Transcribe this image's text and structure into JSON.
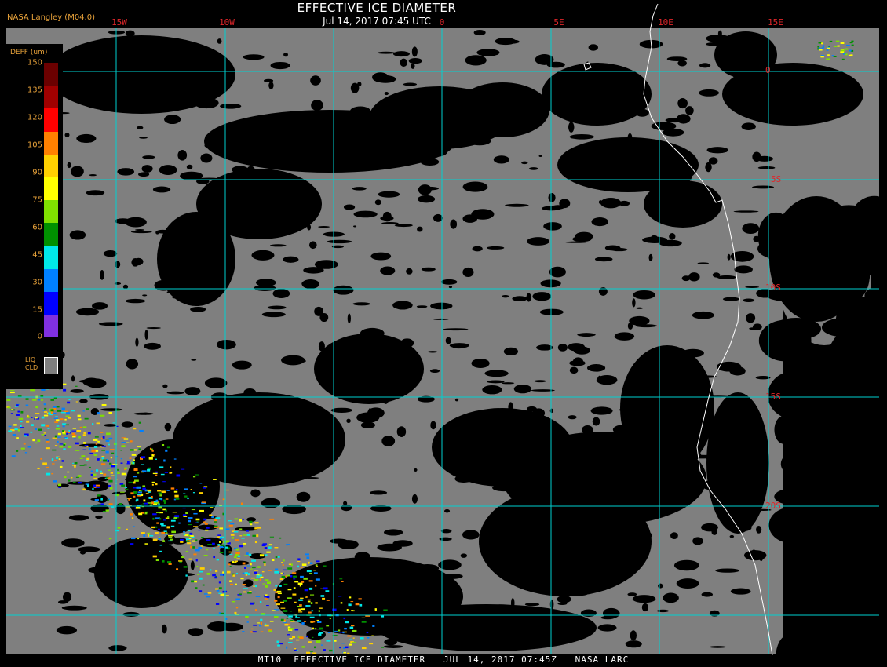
{
  "title": "EFFECTIVE ICE DIAMETER",
  "subtitle": "Jul 14, 2017 07:45 UTC",
  "agency": "NASA Langley (M04.0)",
  "footer": "MT10  EFFECTIVE ICE DIAMETER   JUL 14, 2017 07:45Z   NASA LARC",
  "longitude_labels": [
    "15W",
    "10W",
    "0",
    "5E",
    "10E",
    "15E"
  ],
  "latitude_labels": [
    "0",
    "5S",
    "10S",
    "15S",
    "20S"
  ],
  "legend": {
    "title": "DEFF (um)",
    "ticks": [
      "150",
      "135",
      "120",
      "105",
      "90",
      "75",
      "60",
      "45",
      "30",
      "15",
      "0"
    ],
    "colors": [
      "#6b0000",
      "#a00000",
      "#ff0000",
      "#ff8000",
      "#ffd000",
      "#ffff00",
      "#80e000",
      "#009000",
      "#00e8e8",
      "#0080ff",
      "#0000ff",
      "#8030e0"
    ],
    "liq_label_1": "LIQ",
    "liq_label_2": "CLD"
  },
  "colors": {
    "liquid_cloud": "#7f7f7f",
    "clear": "#000000",
    "grid": "#00d0d0",
    "coast": "#ffffff",
    "label_red": "#e0262a",
    "label_orange": "#e8a23a"
  }
}
